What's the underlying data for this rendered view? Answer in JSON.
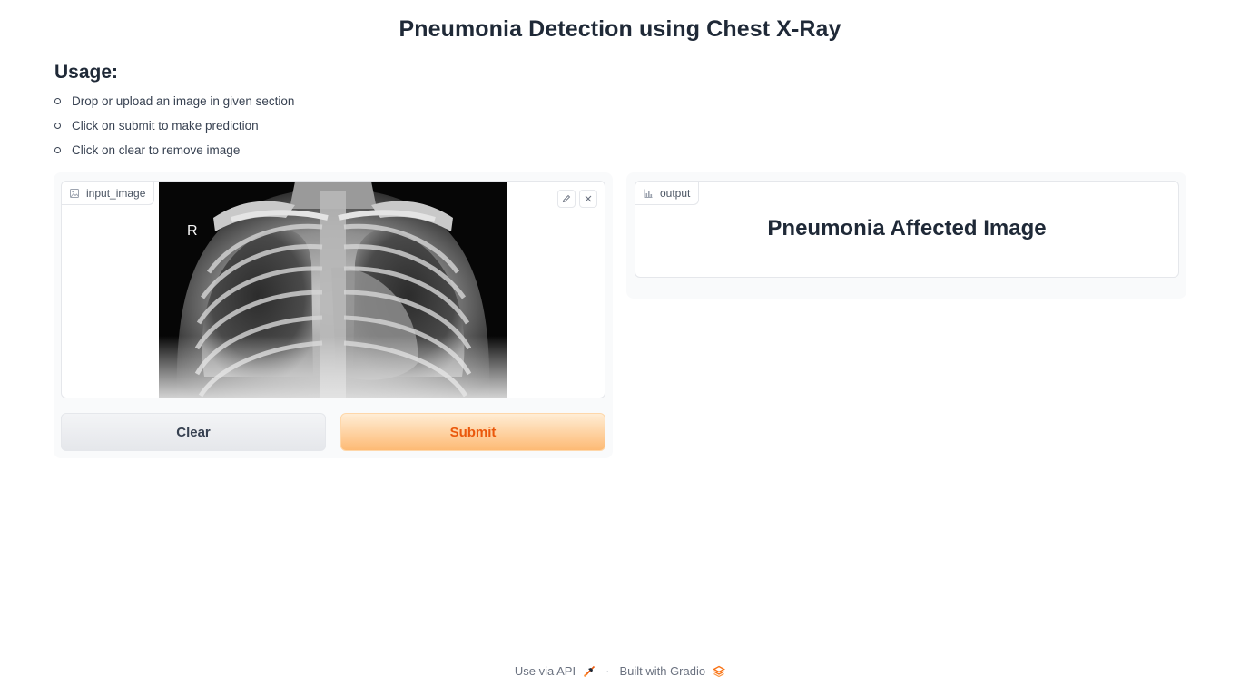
{
  "page": {
    "title": "Pneumonia Detection using Chest X-Ray"
  },
  "usage": {
    "heading": "Usage:",
    "items": [
      "Drop or upload an image in given section",
      "Click on submit to make prediction",
      "Click on clear to remove image"
    ]
  },
  "input_image": {
    "label": "input_image",
    "label_icon": "image-icon",
    "xray_marker": "R",
    "tools": {
      "edit_icon": "pencil-icon",
      "clear_icon": "close-icon"
    }
  },
  "buttons": {
    "clear_label": "Clear",
    "submit_label": "Submit"
  },
  "output": {
    "label": "output",
    "label_icon": "bar-chart-icon",
    "value": "Pneumonia Affected Image"
  },
  "footer": {
    "api_label": "Use via API",
    "api_icon": "rocket-icon",
    "separator": "·",
    "built_label": "Built with Gradio",
    "gradio_icon": "gradio-logo-icon"
  },
  "colors": {
    "accent": "#ea580c",
    "submit_gradient_top": "#ffedd5",
    "submit_gradient_bottom": "#fdba74",
    "panel_background": "#f9fafb"
  }
}
